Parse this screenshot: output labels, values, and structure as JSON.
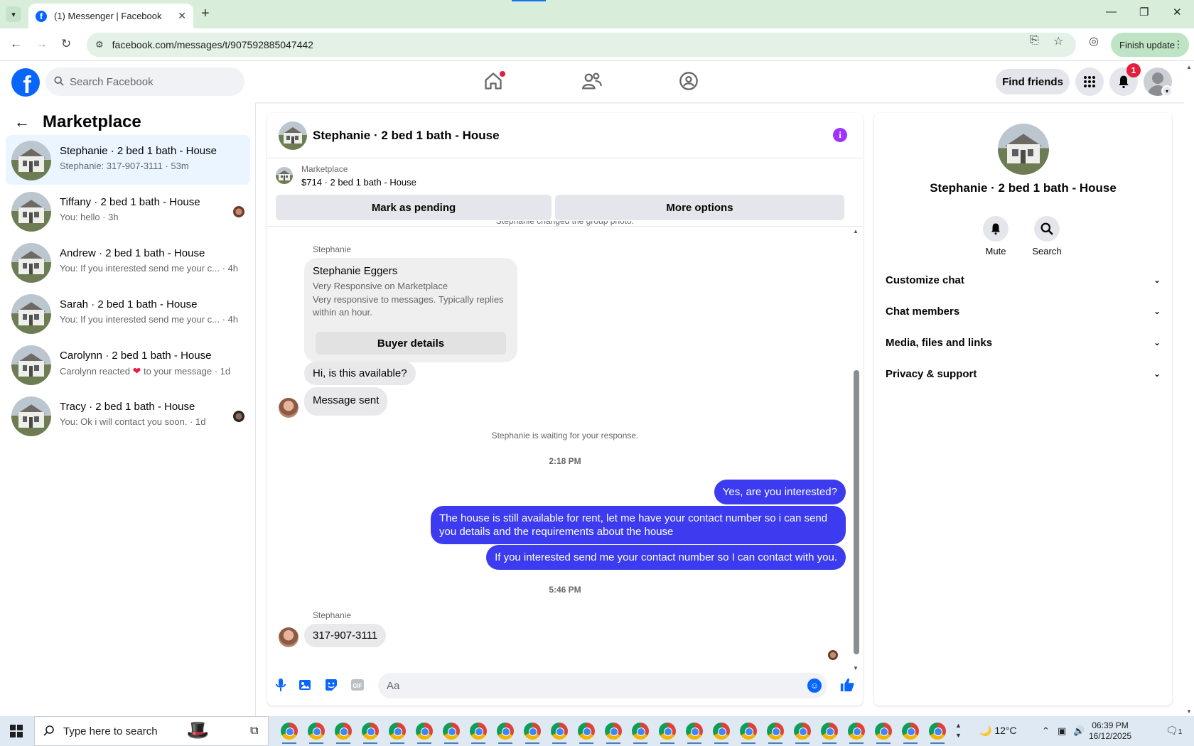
{
  "browser": {
    "tab_title": "(1) Messenger | Facebook",
    "url": "facebook.com/messages/t/907592885047442",
    "finish_update": "Finish update"
  },
  "fb_header": {
    "search_placeholder": "Search Facebook",
    "find_friends": "Find friends",
    "notification_count": "1"
  },
  "sidebar": {
    "title": "Marketplace",
    "chats": [
      {
        "name": "Stephanie · 2 bed 1 bath - House",
        "preview": "Stephanie: 317-907-3111 · 53m"
      },
      {
        "name": "Tiffany · 2 bed 1 bath - House",
        "preview": "You: hello · 3h"
      },
      {
        "name": "Andrew · 2 bed 1 bath - House",
        "preview": "You: If you interested send me your c... · 4h"
      },
      {
        "name": "Sarah · 2 bed 1 bath - House",
        "preview": "You: If you interested send me your c... · 4h"
      },
      {
        "name": "Carolynn · 2 bed 1 bath - House",
        "preview_prefix": "Carolynn reacted",
        "preview_suffix": "to your message · 1d"
      },
      {
        "name": "Tracy · 2 bed 1 bath - House",
        "preview": "You: Ok i will contact you soon. · 1d"
      }
    ]
  },
  "conversation": {
    "title": "Stephanie · 2 bed 1 bath - House",
    "listing_source": "Marketplace",
    "listing_price": "$714 · 2 bed 1 bath - House",
    "mark_pending": "Mark as pending",
    "more_options": "More options",
    "system_top": "Stephanie changed the group photo.",
    "sender_1": "Stephanie",
    "card_name": "Stephanie Eggers",
    "card_line1": "Very Responsive on Marketplace",
    "card_line2": "Very responsive to messages. Typically replies within an hour.",
    "card_button": "Buyer details",
    "msg_in_1": "Hi, is this available?",
    "msg_in_2": "Message sent",
    "waiting": "Stephanie is waiting for your response.",
    "time_1": "2:18 PM",
    "msg_out_1": "Yes, are you interested?",
    "msg_out_2": "The house is still available for rent, let me have your contact number so i can send you details and the requirements about the house",
    "msg_out_3": "If you interested send me your contact number so I can contact with you.",
    "time_2": "5:46 PM",
    "sender_2": "Stephanie",
    "msg_in_3": "317-907-3111",
    "composer_placeholder": "Aa"
  },
  "info_panel": {
    "name": "Stephanie · 2 bed 1 bath - House",
    "mute": "Mute",
    "search": "Search",
    "rows": [
      "Customize chat",
      "Chat members",
      "Media, files and links",
      "Privacy & support"
    ]
  },
  "taskbar": {
    "search_placeholder": "Type here to search",
    "weather": "12°C",
    "time": "06:39 PM",
    "date": "16/12/2025",
    "notif_count": "1"
  },
  "colors": {
    "fb_blue": "#0866ff",
    "outgoing_bubble": "#3c3bf0",
    "info_purple": "#a033ff",
    "badge_red": "#e41e3f"
  }
}
